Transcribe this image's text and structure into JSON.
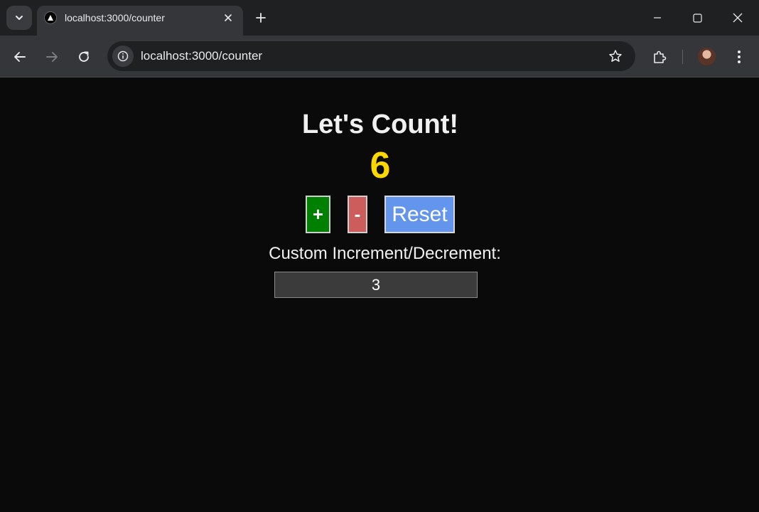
{
  "browser": {
    "tab": {
      "title": "localhost:3000/counter"
    },
    "omnibox": {
      "url": "localhost:3000/counter"
    }
  },
  "page": {
    "title": "Let's Count!",
    "count": "6",
    "buttons": {
      "increment_label": "+",
      "decrement_label": "-",
      "reset_label": "Reset"
    },
    "custom": {
      "label": "Custom Increment/Decrement:",
      "value": "3"
    }
  },
  "colors": {
    "count": "#ffd700",
    "increment": "#008000",
    "decrement": "#cd5c5c",
    "reset": "#6495ed",
    "page_background": "#0a0a0a"
  },
  "icons": [
    "tab-search-icon",
    "nextjs-favicon-icon",
    "close-icon",
    "plus-icon",
    "minimize-icon",
    "maximize-icon",
    "window-close-icon",
    "back-arrow-icon",
    "forward-arrow-icon",
    "reload-icon",
    "site-info-icon",
    "bookmark-star-icon",
    "extensions-icon",
    "profile-avatar",
    "kebab-menu-icon"
  ]
}
